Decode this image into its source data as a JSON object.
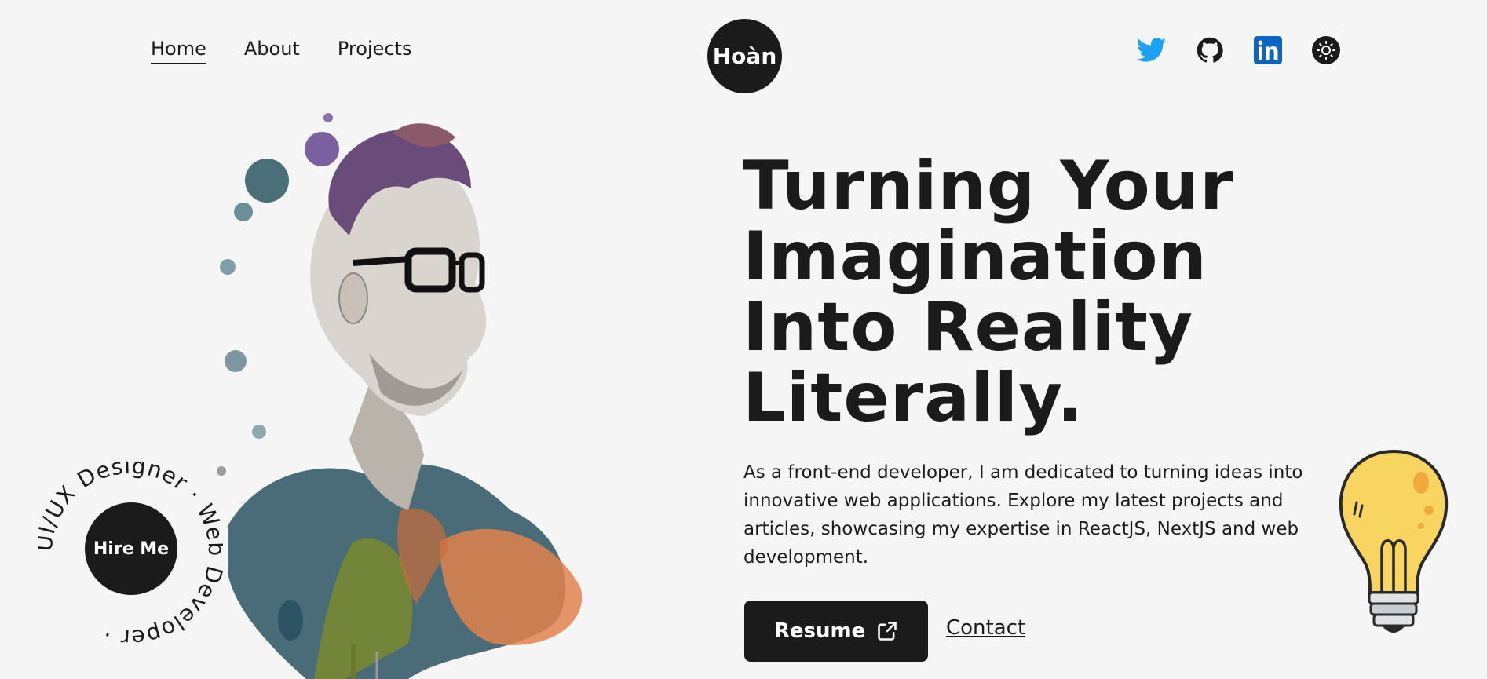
{
  "nav": {
    "links": [
      "Home",
      "About",
      "Projects"
    ],
    "active": "Home"
  },
  "logo": {
    "text": "Hoàn"
  },
  "socials": [
    {
      "icon": "twitter-icon",
      "color": "#1da1f2"
    },
    {
      "icon": "github-icon",
      "color": "#1b1b1b"
    },
    {
      "icon": "linkedin-icon",
      "color": "#0a66c2"
    },
    {
      "icon": "theme-toggle-icon",
      "color": "#1b1b1b"
    }
  ],
  "hero": {
    "headline_lines": [
      "Turning Your",
      "Imagination",
      "Into Reality",
      "Literally."
    ],
    "description": "As a front-end developer, I am dedicated to turning ideas into innovative web applications. Explore my latest projects and articles, showcasing my expertise in ReactJS, NextJS and web development.",
    "resume_label": "Resume",
    "contact_label": "Contact"
  },
  "badge": {
    "button_label": "Hire Me",
    "ring_text": "UI/UX Designer · Web Developer ·"
  },
  "colors": {
    "background": "#f5f5f5",
    "dark": "#1b1b1b",
    "bulb": "#f7d560"
  }
}
